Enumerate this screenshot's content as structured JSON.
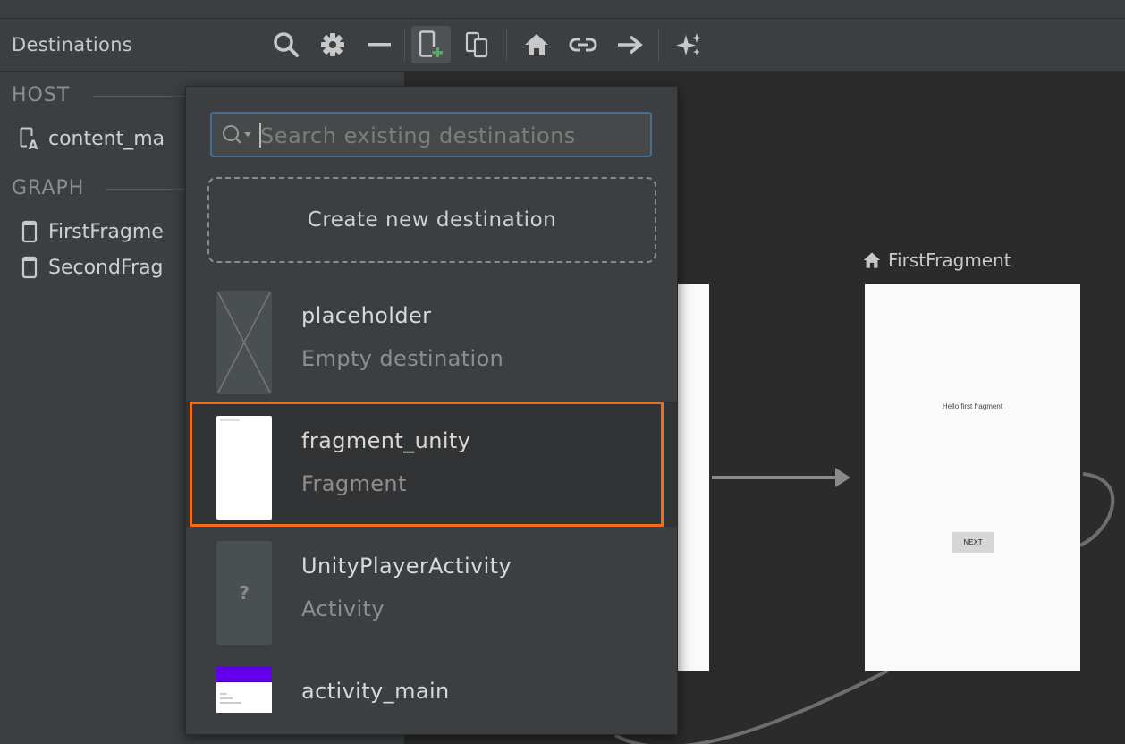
{
  "toolbar": {
    "title": "Destinations",
    "buttons": [
      {
        "name": "search-icon"
      },
      {
        "name": "gear-icon"
      },
      {
        "name": "minus-icon"
      },
      {
        "name": "new-destination-icon",
        "active": true
      },
      {
        "name": "nested-graph-icon"
      },
      {
        "name": "home-icon"
      },
      {
        "name": "link-icon"
      },
      {
        "name": "action-arrow-icon"
      },
      {
        "name": "sparkle-icon"
      }
    ]
  },
  "sidebar": {
    "host_heading": "HOST",
    "host_items": [
      {
        "label": "content_ma",
        "icon": "layout-icon"
      }
    ],
    "graph_heading": "GRAPH",
    "graph_items": [
      {
        "label": "FirstFragme",
        "icon": "phone-icon"
      },
      {
        "label": "SecondFrag",
        "icon": "phone-icon"
      }
    ]
  },
  "canvas": {
    "first_fragment": {
      "title": "FirstFragment",
      "hello_text": "Hello first fragment",
      "next_button": "NEXT"
    }
  },
  "popup": {
    "search_placeholder": "Search existing destinations",
    "create_label": "Create new destination",
    "destinations": [
      {
        "name": "placeholder",
        "type": "Empty destination",
        "thumb": "placeholder"
      },
      {
        "name": "fragment_unity",
        "type": "Fragment",
        "thumb": "fragment",
        "selected": true
      },
      {
        "name": "UnityPlayerActivity",
        "type": "Activity",
        "thumb": "unknown"
      },
      {
        "name": "activity_main",
        "type": "",
        "thumb": "activity"
      }
    ],
    "unknown_glyph": "?"
  },
  "colors": {
    "highlight": "#f26b1d",
    "accent_green": "#59a869",
    "activity_header": "#6200ee"
  }
}
